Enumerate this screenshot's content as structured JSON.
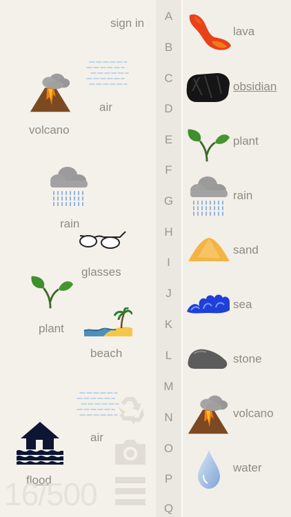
{
  "header": {
    "sign_in": "sign in"
  },
  "alphabet": [
    "A",
    "B",
    "C",
    "D",
    "E",
    "F",
    "G",
    "H",
    "I",
    "J",
    "K",
    "L",
    "M",
    "N",
    "O",
    "P",
    "Q"
  ],
  "library": [
    {
      "label": "lava",
      "icon": "lava-icon"
    },
    {
      "label": "obsidian",
      "icon": "obsidian-icon",
      "underlined": true
    },
    {
      "label": "plant",
      "icon": "plant-icon"
    },
    {
      "label": "rain",
      "icon": "rain-icon"
    },
    {
      "label": "sand",
      "icon": "sand-icon"
    },
    {
      "label": "sea",
      "icon": "sea-icon"
    },
    {
      "label": "stone",
      "icon": "stone-icon"
    },
    {
      "label": "volcano",
      "icon": "volcano-icon"
    },
    {
      "label": "water",
      "icon": "water-icon"
    }
  ],
  "workspace": {
    "volcano": "volcano",
    "air1": "air",
    "rain": "rain",
    "glasses": "glasses",
    "plant": "plant",
    "beach": "beach",
    "air2": "air",
    "flood": "flood"
  },
  "counter": "16/500",
  "tools": [
    "recycle-icon",
    "camera-icon",
    "menu-icon"
  ],
  "colors": {
    "background": "#f3f0ea",
    "alphabet_column": "#ebe8e2",
    "text": "#8f8a82"
  }
}
